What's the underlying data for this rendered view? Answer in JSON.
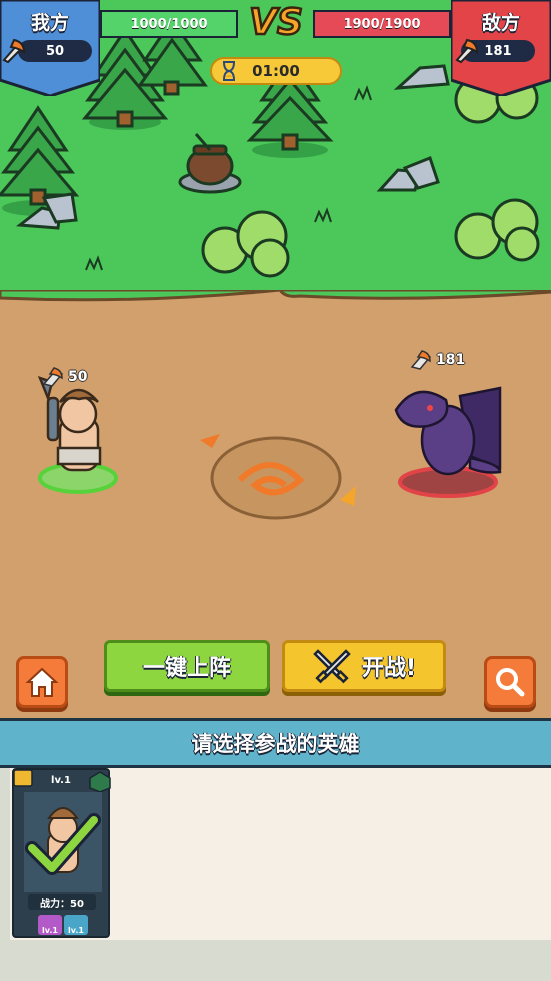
{
  "hud": {
    "left_team": {
      "title": "我方",
      "power": "50",
      "hp": "1000/1000"
    },
    "right_team": {
      "title": "敌方",
      "power": "181",
      "hp": "1900/1900"
    },
    "vs_label": "VS",
    "timer": "01:00"
  },
  "battlefield": {
    "player_unit": {
      "power": "50"
    },
    "enemy_unit": {
      "power": "181"
    }
  },
  "controls": {
    "deploy_label": "一键上阵",
    "fight_label": "开战!"
  },
  "selection": {
    "prompt": "请选择参战的英雄",
    "cards": [
      {
        "level": "lv.1",
        "power_label": "战力：50",
        "skill_levels": [
          "lv.1",
          "lv.1"
        ],
        "selected": true
      }
    ]
  },
  "colors": {
    "grass": "#4cc85a",
    "dirt": "#d2a06c",
    "ally_hp": "#55d36b",
    "enemy_hp": "#e64a56",
    "deploy_button": "#8ed640",
    "fight_button": "#f5c52d",
    "side_button": "#f47b3a",
    "prompt_bar": "#5fb4cc"
  }
}
